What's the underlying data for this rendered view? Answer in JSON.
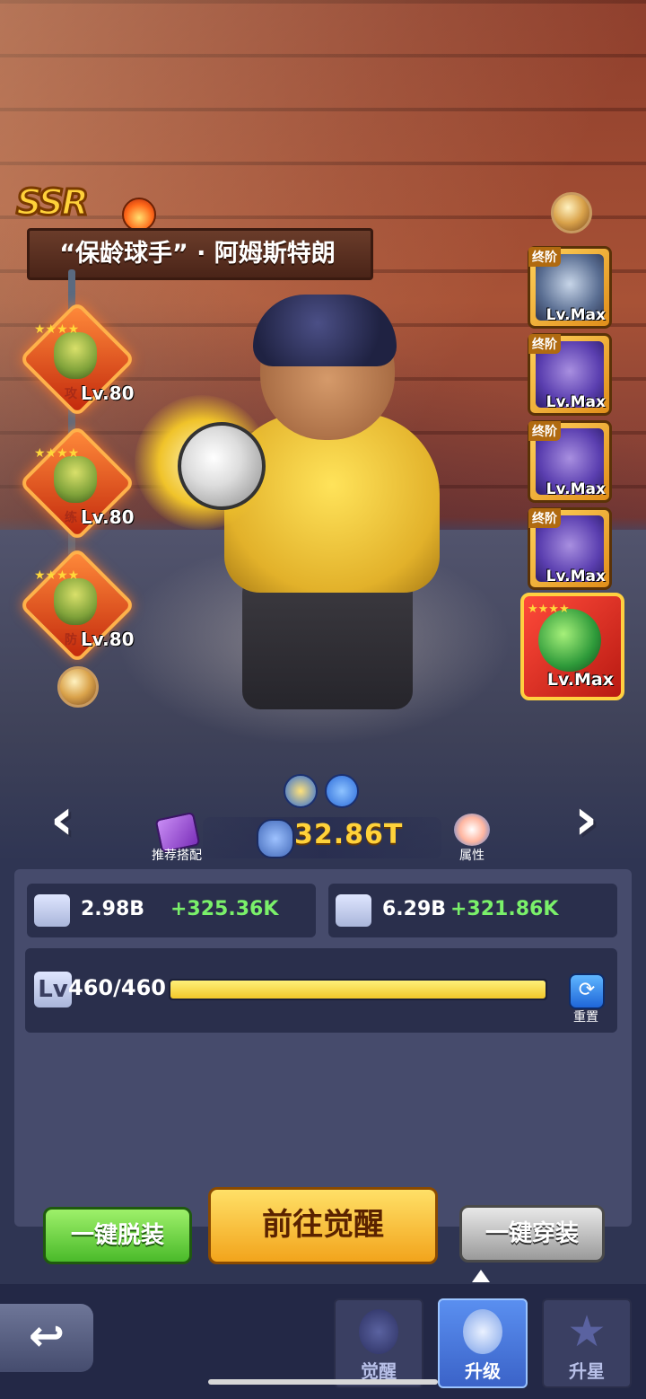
{
  "hero": {
    "rarity": "SSR",
    "name": "“保龄球手” · 阿姆斯特朗",
    "power": "32.86T"
  },
  "companions": [
    {
      "level": "Lv.80",
      "tag": "攻"
    },
    {
      "level": "Lv.80",
      "tag": "练"
    },
    {
      "level": "Lv.80",
      "tag": "防"
    }
  ],
  "equipment": [
    {
      "tag": "终阶",
      "level": "Lv.Max",
      "icon": "axe-icon"
    },
    {
      "tag": "终阶",
      "level": "Lv.Max",
      "icon": "armor-icon"
    },
    {
      "tag": "终阶",
      "level": "Lv.Max",
      "icon": "glove-icon"
    },
    {
      "tag": "终阶",
      "level": "Lv.Max",
      "icon": "helmet-icon"
    },
    {
      "tag": "",
      "level": "Lv.Max",
      "icon": "bowling-ball-icon"
    }
  ],
  "labels": {
    "recommend": "推荐搭配",
    "attributes": "属性",
    "reset": "重置"
  },
  "stats": {
    "attack": {
      "value": "2.98B",
      "delta": "+325.36K"
    },
    "hp": {
      "value": "6.29B",
      "delta": "+321.86K"
    }
  },
  "level": {
    "badge": "Lv",
    "text": "460/460",
    "progress": 1.0
  },
  "buttons": {
    "unequip_all": "一键脱装",
    "go_awaken": "前往觉醒",
    "equip_all": "一键穿装"
  },
  "tabs": [
    {
      "label": "觉醒",
      "active": false
    },
    {
      "label": "升级",
      "active": true
    },
    {
      "label": "升星",
      "active": false
    }
  ],
  "colors": {
    "power": "#ffd23a",
    "stat_delta": "#7af06a",
    "active_tab": "#3b63c8"
  }
}
